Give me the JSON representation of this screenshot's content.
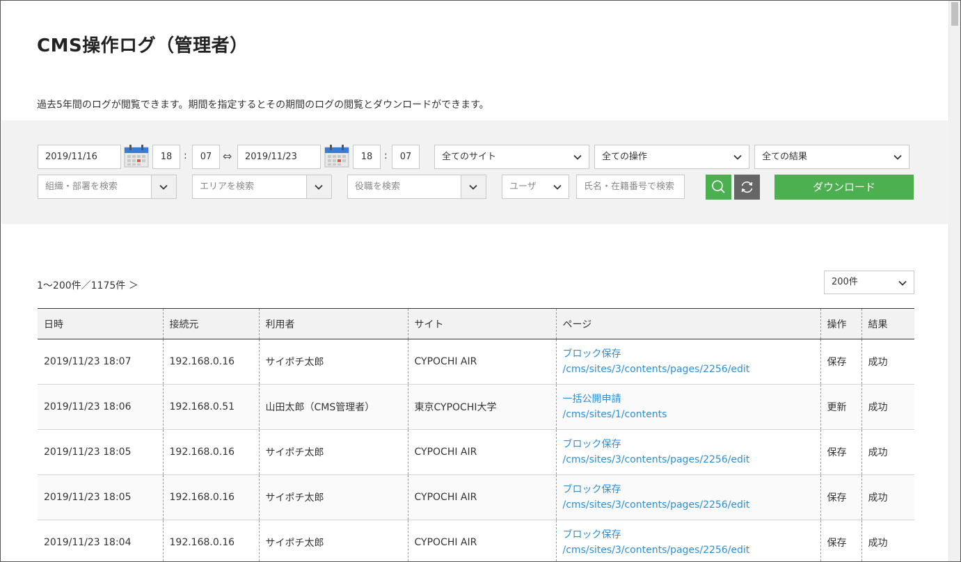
{
  "header": {
    "title": "CMS操作ログ（管理者）",
    "description": "過去5年間のログが閲覧できます。期間を指定するとその期間のログの閲覧とダウンロードができます。"
  },
  "filters": {
    "start_date": "2019/11/16",
    "start_hour": "18",
    "start_minute": "07",
    "time_separator": ":",
    "range_separator": "⇔",
    "end_date": "2019/11/23",
    "end_hour": "18",
    "end_minute": "07",
    "site_select": "全てのサイト",
    "operation_select": "全ての操作",
    "result_select": "全ての結果",
    "org_placeholder": "組織・部署を検索",
    "area_placeholder": "エリアを検索",
    "role_placeholder": "役職を検索",
    "user_type_select": "ユーザ",
    "name_placeholder": "氏名・在籍番号で検索",
    "download_label": "ダウンロード"
  },
  "results": {
    "count_text": "1～200件／1175件 ＞",
    "per_page": "200件"
  },
  "table": {
    "headers": [
      "日時",
      "接続元",
      "利用者",
      "サイト",
      "ページ",
      "操作",
      "結果"
    ],
    "rows": [
      {
        "datetime": "2019/11/23 18:07",
        "ip": "192.168.0.16",
        "user": "サイポチ太郎",
        "site": "CYPOCHI AIR",
        "page_title": "ブロック保存",
        "page_path": "/cms/sites/3/contents/pages/2256/edit",
        "operation": "保存",
        "result": "成功"
      },
      {
        "datetime": "2019/11/23 18:06",
        "ip": "192.168.0.51",
        "user": "山田太郎（CMS管理者）",
        "site": "東京CYPOCHI大学",
        "page_title": "一括公開申請",
        "page_path": "/cms/sites/1/contents",
        "operation": "更新",
        "result": "成功"
      },
      {
        "datetime": "2019/11/23 18:05",
        "ip": "192.168.0.16",
        "user": "サイポチ太郎",
        "site": "CYPOCHI AIR",
        "page_title": "ブロック保存",
        "page_path": "/cms/sites/3/contents/pages/2256/edit",
        "operation": "保存",
        "result": "成功"
      },
      {
        "datetime": "2019/11/23 18:05",
        "ip": "192.168.0.16",
        "user": "サイポチ太郎",
        "site": "CYPOCHI AIR",
        "page_title": "ブロック保存",
        "page_path": "/cms/sites/3/contents/pages/2256/edit",
        "operation": "保存",
        "result": "成功"
      },
      {
        "datetime": "2019/11/23 18:04",
        "ip": "192.168.0.16",
        "user": "サイポチ太郎",
        "site": "CYPOCHI AIR",
        "page_title": "ブロック保存",
        "page_path": "/cms/sites/3/contents/pages/2256/edit",
        "operation": "保存",
        "result": "成功"
      }
    ]
  },
  "icons": {
    "calendar": "calendar-icon",
    "chevron": "chevron-down-icon",
    "search": "search-icon",
    "reset": "refresh-icon"
  },
  "colors": {
    "accent_green": "#4caf50",
    "link_blue": "#2a8fd6",
    "reset_gray": "#666666",
    "panel_bg": "#f2f2f2"
  }
}
